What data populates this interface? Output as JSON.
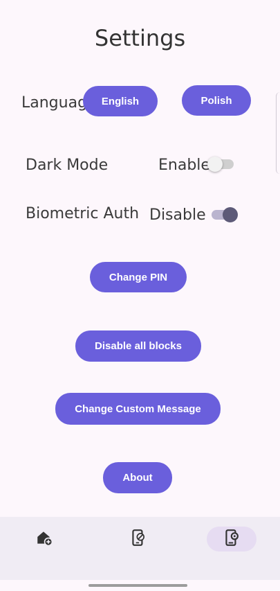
{
  "header": {
    "title": "Settings"
  },
  "language": {
    "label": "Language",
    "english": "English",
    "polish": "Polish"
  },
  "dark_mode": {
    "label": "Dark Mode",
    "state_text": "Enable",
    "enabled": false
  },
  "biometric": {
    "label": "Biometric Auth",
    "state_text": "Disable",
    "enabled": true
  },
  "actions": {
    "change_pin": "Change PIN",
    "disable_blocks": "Disable all blocks",
    "change_message": "Change Custom Message",
    "about": "About"
  },
  "nav": {
    "items": [
      {
        "icon": "home-add-icon",
        "active": false
      },
      {
        "icon": "phone-block-icon",
        "active": false
      },
      {
        "icon": "phone-settings-icon",
        "active": true
      }
    ]
  },
  "colors": {
    "accent": "#6a5fdc",
    "background": "#fdf7fc",
    "nav_bg": "#f0ecf4",
    "nav_active": "#e6dcf2"
  }
}
